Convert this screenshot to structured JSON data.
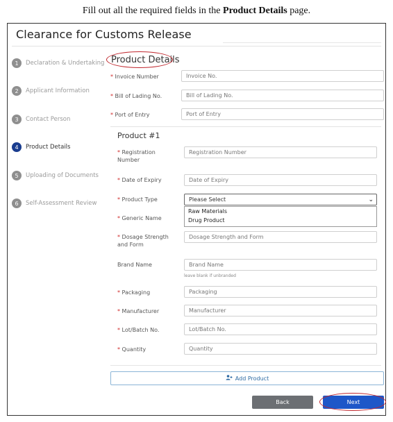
{
  "caption": {
    "prefix": "Fill out all the required fields in the ",
    "bold": "Product Details",
    "suffix": " page."
  },
  "app": {
    "title": "Clearance for Customs Release"
  },
  "steps": [
    {
      "num": "1",
      "label": "Declaration & Undertaking"
    },
    {
      "num": "2",
      "label": "Applicant Information"
    },
    {
      "num": "3",
      "label": "Contact Person"
    },
    {
      "num": "4",
      "label": "Product Details"
    },
    {
      "num": "5",
      "label": "Uploading of Documents"
    },
    {
      "num": "6",
      "label": "Self-Assessment Review"
    }
  ],
  "active_step": "4",
  "section": {
    "title": "Product Details"
  },
  "shipment": {
    "invoice": {
      "label": "Invoice Number",
      "placeholder": "Invoice No."
    },
    "bill": {
      "label": "Bill of Lading No.",
      "placeholder": "Bill of Lading No."
    },
    "port": {
      "label": "Port of Entry",
      "placeholder": "Port of Entry"
    }
  },
  "product": {
    "title": "Product #1",
    "registration": {
      "label_1": "Registration",
      "label_2": "Number",
      "placeholder": "Registration Number"
    },
    "expiry": {
      "label": "Date of Expiry",
      "placeholder": "Date of Expiry"
    },
    "type": {
      "label": "Product Type",
      "selected": "Please Select",
      "options": [
        "Raw Materials",
        "Drug Product"
      ]
    },
    "generic": {
      "label": "Generic Name"
    },
    "dosage": {
      "label_1": "Dosage Strength",
      "label_2": "and Form",
      "placeholder": "Dosage Strength and Form"
    },
    "brand": {
      "label": "Brand Name",
      "placeholder": "Brand Name",
      "hint": "leave blank if unbranded"
    },
    "packaging": {
      "label": "Packaging",
      "placeholder": "Packaging"
    },
    "manufacturer": {
      "label": "Manufacturer",
      "placeholder": "Manufacturer"
    },
    "lot": {
      "label": "Lot/Batch No.",
      "placeholder": "Lot/Batch No."
    },
    "quantity": {
      "label": "Quantity",
      "placeholder": "Quantity"
    }
  },
  "required_mark": "*",
  "buttons": {
    "add_product": "Add Product",
    "back": "Back",
    "next": "Next"
  },
  "icons": {
    "add_product": "add-user-icon",
    "select": "chevron-down-icon"
  },
  "colors": {
    "primary": "#1e57c8",
    "secondary": "#6c6f73",
    "annotation": "#c0252c",
    "active_step": "#1a3d8f",
    "required": "#d12c2c"
  }
}
